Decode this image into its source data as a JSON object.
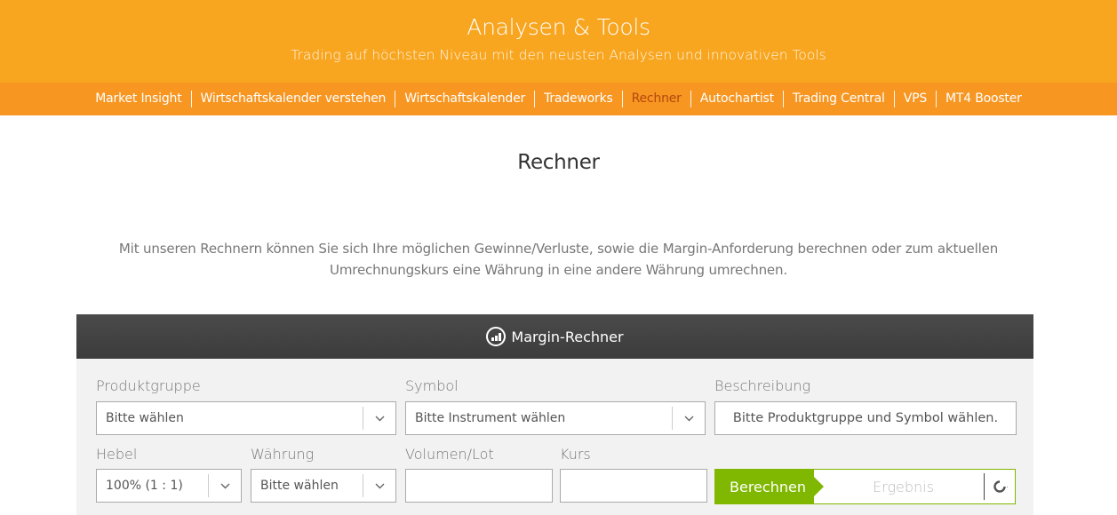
{
  "hero": {
    "title": "Analysen & Tools",
    "subtitle": "Trading auf höchsten Niveau mit den neusten Analysen und innovativen Tools"
  },
  "subnav": {
    "items": [
      {
        "label": "Market Insight",
        "active": false
      },
      {
        "label": "Wirtschaftskalender verstehen",
        "active": false
      },
      {
        "label": "Wirtschaftskalender",
        "active": false
      },
      {
        "label": "Tradeworks",
        "active": false
      },
      {
        "label": "Rechner",
        "active": true
      },
      {
        "label": "Autochartist",
        "active": false
      },
      {
        "label": "Trading Central",
        "active": false
      },
      {
        "label": "VPS",
        "active": false
      },
      {
        "label": "MT4 Booster",
        "active": false
      }
    ]
  },
  "page": {
    "title": "Rechner",
    "intro": "Mit unseren Rechnern können Sie sich Ihre möglichen Gewinne/Verluste, sowie die Margin-Anforderung berechnen oder zum aktuellen Umrechnungskurs eine Währung in eine andere Währung umrechnen."
  },
  "calculator": {
    "title": "Margin-Rechner",
    "icon": "chart-growth-icon",
    "produktgruppe": {
      "label": "Produktgruppe",
      "value": "Bitte wählen"
    },
    "symbol": {
      "label": "Symbol",
      "value": "Bitte Instrument wählen"
    },
    "beschreibung": {
      "label": "Beschreibung",
      "value": "Bitte Produktgruppe und Symbol wählen."
    },
    "hebel": {
      "label": "Hebel",
      "value": "100% (1 : 1)"
    },
    "waehrung": {
      "label": "Währung",
      "value": "Bitte wählen"
    },
    "volumen": {
      "label": "Volumen/Lot",
      "value": ""
    },
    "kurs": {
      "label": "Kurs",
      "value": ""
    },
    "calculate_label": "Berechnen",
    "result_placeholder": "Ergebnis",
    "reset_icon": "refresh-icon"
  },
  "colors": {
    "hero_bg": "#f8a51f",
    "subnav_bg": "#f79621",
    "active_nav": "#b5480e",
    "calc_header_bg": "#444444",
    "calc_button": "#80b700"
  }
}
